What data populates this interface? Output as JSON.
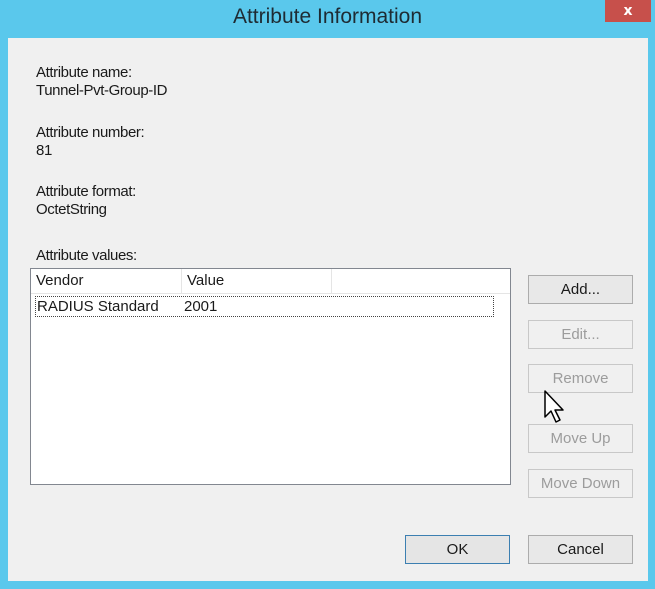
{
  "window": {
    "title": "Attribute Information",
    "close_glyph": "x"
  },
  "fields": {
    "name_label": "Attribute name:",
    "name_value": "Tunnel-Pvt-Group-ID",
    "number_label": "Attribute number:",
    "number_value": "81",
    "format_label": "Attribute format:",
    "format_value": "OctetString",
    "values_label": "Attribute values:"
  },
  "table": {
    "columns": [
      "Vendor",
      "Value"
    ],
    "rows": [
      {
        "vendor": "RADIUS Standard",
        "value": "2001"
      }
    ]
  },
  "buttons": {
    "add": "Add...",
    "edit": "Edit...",
    "remove": "Remove",
    "move_up": "Move Up",
    "move_down": "Move Down",
    "ok": "OK",
    "cancel": "Cancel"
  },
  "colors": {
    "titlebar": "#5ac8ec",
    "close_button": "#c7504b",
    "client_background": "#f0f0f0",
    "disabled_text": "#9c9c9c",
    "default_button_border": "#3c7fb1"
  },
  "icons": {
    "close": "close-icon",
    "cursor": "mouse-pointer-icon"
  }
}
